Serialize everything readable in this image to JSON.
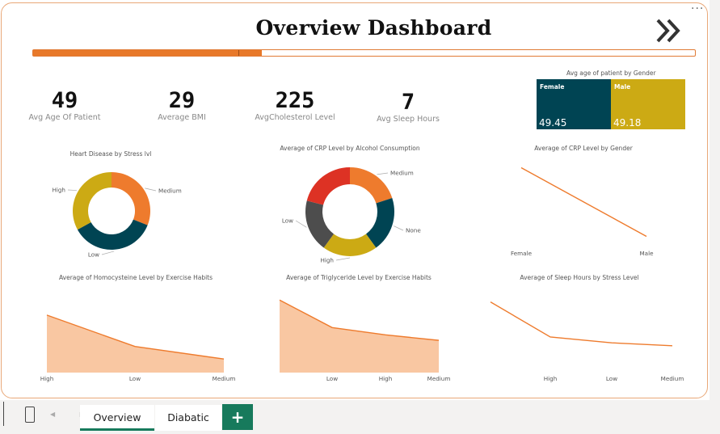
{
  "header": {
    "title": "Overview Dashboard",
    "more_icon": "ellipsis-icon",
    "nav_icon": "double-chevron-right-icon"
  },
  "progress": {
    "filled_fraction": 0.345,
    "segment_at_fraction": 0.31,
    "color": "#e8792a"
  },
  "kpis": [
    {
      "value": "49",
      "label": "Avg Age Of Patient"
    },
    {
      "value": "29",
      "label": "Average BMI"
    },
    {
      "value": "225",
      "label": "AvgCholesterol Level"
    },
    {
      "value": "7",
      "label": "Avg Sleep Hours"
    }
  ],
  "treemap": {
    "title": "Avg age of patient by Gender",
    "tiles": [
      {
        "name": "Female",
        "value": "49.45",
        "color": "#004453"
      },
      {
        "name": "Male",
        "value": "49.18",
        "color": "#ccaa14"
      }
    ]
  },
  "colors": {
    "orange": "#ee7b2d",
    "teal": "#004453",
    "gold": "#ccaa14",
    "red": "#dd3224",
    "gray": "#4d4d4d",
    "area": "#f9c7a2"
  },
  "chart_data": [
    {
      "type": "pie",
      "title": "Heart Disease by Stress lvl",
      "donut": true,
      "categories": [
        "Medium",
        "Low",
        "High"
      ],
      "values": [
        31,
        36,
        33
      ],
      "colors": [
        "#ee7b2d",
        "#004453",
        "#ccaa14"
      ]
    },
    {
      "type": "pie",
      "title": "Average of CRP Level by Alcohol Consumption",
      "donut": true,
      "categories": [
        "Medium",
        "None",
        "High",
        "Low",
        ""
      ],
      "values": [
        20,
        20,
        20,
        19,
        21
      ],
      "colors": [
        "#ee7b2d",
        "#004453",
        "#ccaa14",
        "#4d4d4d",
        "#dd3224"
      ]
    },
    {
      "type": "line",
      "title": "Average of CRP Level by Gender",
      "categories": [
        "Female",
        "Male"
      ],
      "values": [
        7.55,
        7.45
      ],
      "ylim": [
        7.44,
        7.56
      ]
    },
    {
      "type": "area",
      "title": "Average of Homocysteine Level by Exercise Habits",
      "categories": [
        "High",
        "Low",
        "Medium"
      ],
      "values": [
        12.5,
        12.0,
        11.8
      ],
      "ylim": [
        11.7,
        12.55
      ]
    },
    {
      "type": "area",
      "title": "Average of Triglyceride Level by Exercise Habits",
      "categories": [
        "",
        "Low",
        "High",
        "Medium"
      ],
      "values": [
        265,
        250,
        246,
        243
      ],
      "ylim": [
        236,
        266
      ]
    },
    {
      "type": "line",
      "title": "Average of Sleep Hours by Stress Level",
      "categories": [
        "",
        "High",
        "Low",
        "Medium"
      ],
      "values": [
        7.13,
        7.01,
        6.99,
        6.98
      ],
      "ylim": [
        6.96,
        7.14
      ]
    }
  ],
  "tabs": {
    "items": [
      {
        "label": "Overview",
        "active": true
      },
      {
        "label": "Diabatic",
        "active": false
      }
    ],
    "add_label": "+",
    "phone_icon": "mobile-layout-icon",
    "nav_arrows": "◀ ▶"
  }
}
